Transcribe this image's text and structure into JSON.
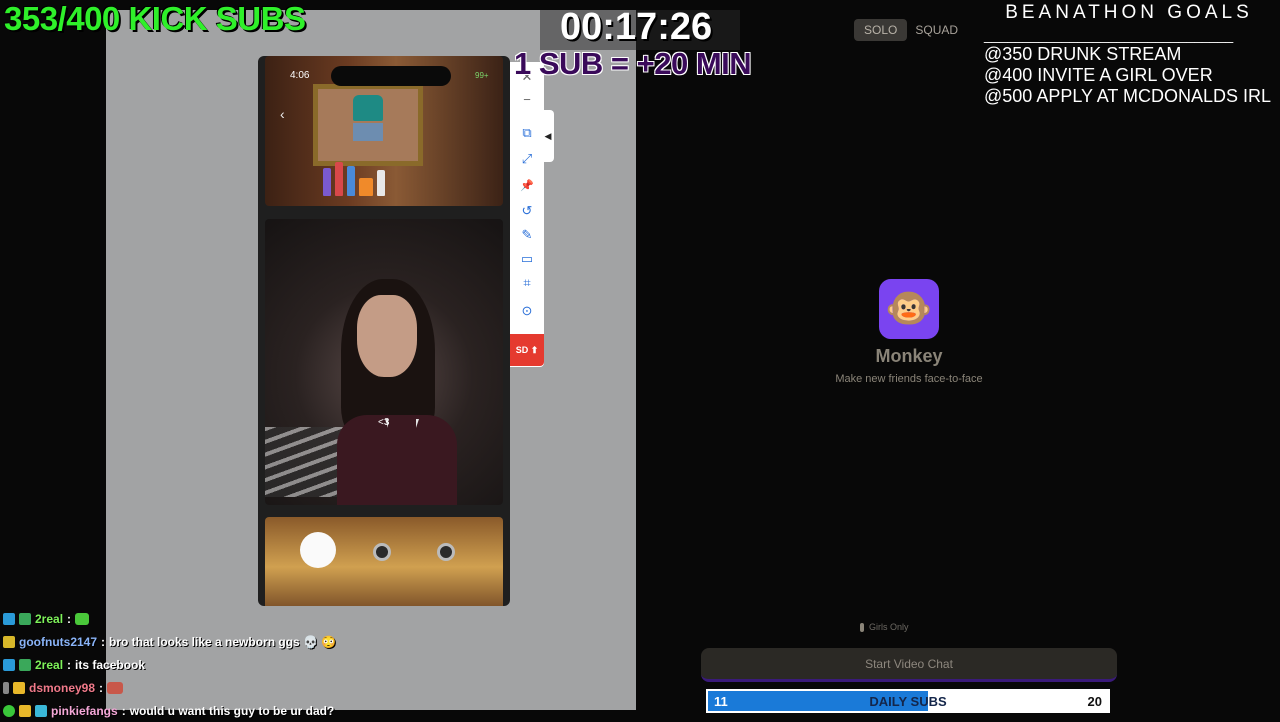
{
  "overlay": {
    "subs_counter": "353/400 KICK SUBS",
    "timer": "00:17:26",
    "sub_rule": "1 SUB = +20 MIN",
    "goals": {
      "title": "BEANATHON GOALS",
      "rule": "________________________________",
      "items": [
        "@350 DRUNK  STREAM",
        "@400 INVITE A GIRL OVER",
        "@500 APPLY AT MCDONALDS IRL"
      ]
    },
    "daily_subs": {
      "current": "11",
      "label": "DAILY SUBS",
      "goal": "20",
      "progress": 0.55
    }
  },
  "phone": {
    "status_time": "4:06",
    "signal_badge": "99+",
    "back_glyph": "‹",
    "overlay_text": "<3"
  },
  "toolbar": {
    "buttons": [
      {
        "name": "close-icon",
        "glyph": "✕"
      },
      {
        "name": "minimize-icon",
        "glyph": "−"
      },
      {
        "name": "screenshot-icon",
        "glyph": "⧉"
      },
      {
        "name": "fullscreen-icon",
        "glyph": "⤢"
      },
      {
        "name": "pin-icon",
        "glyph": "📌"
      },
      {
        "name": "rotate-icon",
        "glyph": "↺"
      },
      {
        "name": "pen-icon",
        "glyph": "✎"
      },
      {
        "name": "screen-icon",
        "glyph": "▭"
      },
      {
        "name": "crop-icon",
        "glyph": "⌗"
      },
      {
        "name": "record-icon",
        "glyph": "⊙"
      }
    ],
    "sd_label": "SD",
    "collapse_glyph": "◀"
  },
  "app": {
    "mode_options": [
      "SOLO",
      "SQUAD"
    ],
    "selected_mode": "SOLO",
    "icon_glyph": "🐵",
    "name": "Monkey",
    "tagline": "Make new friends face-to-face",
    "gender_filter": "Girls Only",
    "start_button": "Start Video Chat"
  },
  "chat": {
    "messages": [
      {
        "user": "2real",
        "user_color": "#7ef25a",
        "separator": " :",
        "text": "",
        "badge_color": "#2a9ad8",
        "badge2_color": "#3aa85a",
        "emote_color": "#4ac83a"
      },
      {
        "user": "goofnuts2147",
        "user_color": "#8ab4f8",
        "separator": " :",
        "text": "bro that looks like a newborn ggs 💀 😳",
        "badge_color": "#d8b82a",
        "badge2_color": "",
        "emote_color": ""
      },
      {
        "user": "2real",
        "user_color": "#7ef25a",
        "separator": " :",
        "text": "its facebook",
        "badge_color": "#2a9ad8",
        "badge2_color": "#3aa85a",
        "emote_color": ""
      },
      {
        "user": "dsmoney98",
        "user_color": "#f07a8a",
        "separator": " :",
        "text": "",
        "badge_color": "#888",
        "badge2_color": "#e8b82a",
        "emote_color": "#c8584a"
      },
      {
        "user": "pinkiefangs",
        "user_color": "#f5a8d8",
        "separator": " :",
        "text": "would u want this guy to be ur dad?",
        "badge_color": "#3ac83a",
        "badge2_color": "#e8b82a",
        "emote_color": ""
      }
    ]
  },
  "colors": {
    "subs_green": "#2ff02a",
    "sub_rule_purple": "#3a0a5a",
    "monkey_purple": "#7a44f0",
    "toolbar_red": "#e53a2f",
    "daily_fill_blue": "#1a7ad8"
  }
}
